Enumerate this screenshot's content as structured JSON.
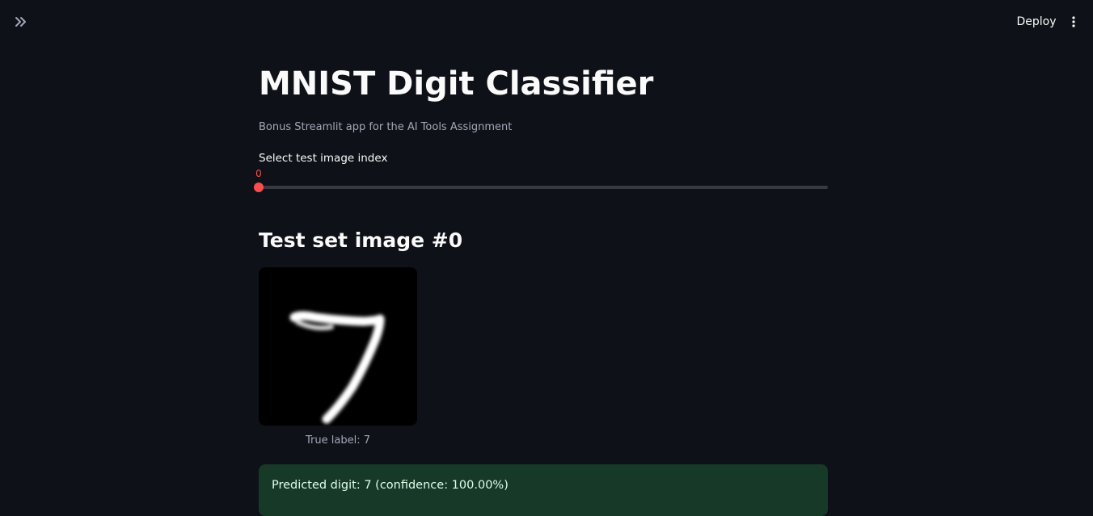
{
  "header": {
    "sidebar_toggle_icon": "double-chevron-right-icon",
    "deploy_label": "Deploy",
    "menu_icon": "vertical-ellipsis-icon"
  },
  "main": {
    "title": "MNIST Digit Classifier",
    "caption": "Bonus Streamlit app for the AI Tools Assignment",
    "slider": {
      "label": "Select test image index",
      "value": "0",
      "fraction": 0
    },
    "image_heading": "Test set image #0",
    "image_caption": "True label: 7",
    "prediction": "Predicted digit: 7 (confidence: 100.00%)"
  },
  "colors": {
    "background": "#0e1117",
    "accent": "#ff4b4b",
    "success_bg": "#173928",
    "success_text": "#dffde9"
  }
}
